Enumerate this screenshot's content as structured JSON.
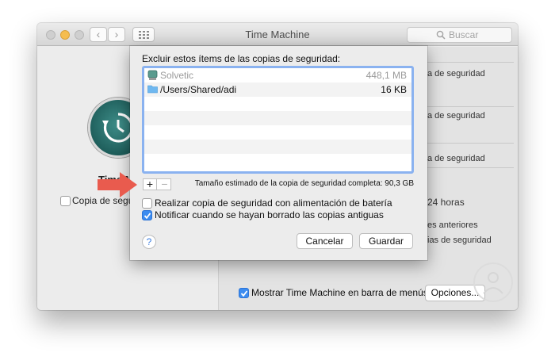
{
  "window": {
    "title": "Time Machine",
    "search_placeholder": "Buscar"
  },
  "left_pane": {
    "app_label": "Time Ma",
    "backup_checkbox_label": "Copia de segu",
    "backup_checkbox_checked": false
  },
  "right_pane": {
    "lines": [
      "a de seguridad",
      "a de seguridad",
      "a de seguridad"
    ],
    "hours_text": "24 horas",
    "previous_text": "es anteriores",
    "backup_text": "ias de seguridad",
    "menu_bar_checkbox_label": "Mostrar Time Machine en barra de menús",
    "menu_bar_checkbox_checked": true,
    "options_button": "Opciones..."
  },
  "sheet": {
    "heading": "Excluir estos ítems de las copias de seguridad:",
    "items": [
      {
        "name": "Solvetic",
        "size": "448,1 MB",
        "icon": "drive-icon",
        "dimmed": true
      },
      {
        "name": "/Users/Shared/adi",
        "size": "16 KB",
        "icon": "folder-icon",
        "dimmed": false
      }
    ],
    "add_label": "+",
    "remove_label": "−",
    "estimate": "Tamaño estimado de la copia de seguridad completa: 90,3 GB",
    "battery_checkbox_label": "Realizar copia de seguridad con alimentación de batería",
    "battery_checkbox_checked": false,
    "notify_checkbox_label": "Notificar cuando se hayan borrado las copias antiguas",
    "notify_checkbox_checked": true,
    "help_label": "?",
    "cancel_button": "Cancelar",
    "save_button": "Guardar"
  },
  "colors": {
    "accent": "#3c8cf0",
    "focus_ring": "#8ab2f0",
    "annotation_arrow": "#e95b4e",
    "tm_icon": "#1f5f5c"
  }
}
